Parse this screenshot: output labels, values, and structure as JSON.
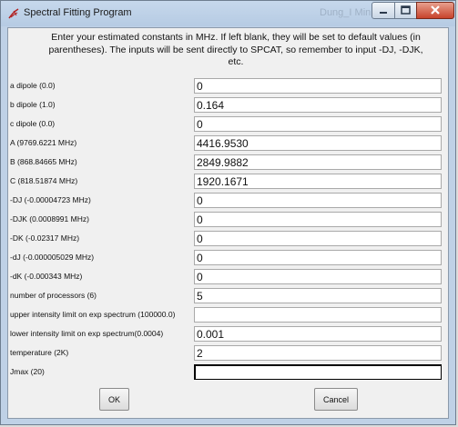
{
  "window": {
    "title": "Spectral Fitting Program",
    "background_title": "Dung_I Min Ver"
  },
  "intro_text": "Enter your estimated constants in MHz. If left blank, they will be set to default values (in parentheses). The inputs will be sent directly to SPCAT, so remember to input -DJ, -DJK, etc.",
  "fields": [
    {
      "label": "a dipole (0.0)",
      "value": "0"
    },
    {
      "label": "b dipole (1.0)",
      "value": "0.164"
    },
    {
      "label": "c dipole (0.0)",
      "value": "0"
    },
    {
      "label": "A (9769.6221 MHz)",
      "value": "4416.9530"
    },
    {
      "label": "B (868.84665 MHz)",
      "value": "2849.9882"
    },
    {
      "label": "C (818.51874 MHz)",
      "value": "1920.1671"
    },
    {
      "label": "-DJ (-0.00004723 MHz)",
      "value": "0"
    },
    {
      "label": "-DJK (0.0008991 MHz)",
      "value": "0"
    },
    {
      "label": "-DK (-0.02317 MHz)",
      "value": "0"
    },
    {
      "label": "-dJ (-0.000005029 MHz)",
      "value": "0"
    },
    {
      "label": "-dK (-0.000343 MHz)",
      "value": "0"
    },
    {
      "label": "number of processors (6)",
      "value": "5"
    },
    {
      "label": "upper intensity limit on exp spectrum (100000.0)",
      "value": ""
    },
    {
      "label": "lower intensity limit on exp spectrum(0.0004)",
      "value": "0.001"
    },
    {
      "label": "temperature (2K)",
      "value": "2"
    },
    {
      "label": "Jmax (20)",
      "value": ""
    }
  ],
  "buttons": {
    "ok_label": "OK",
    "cancel_label": "Cancel"
  },
  "icons": {
    "app": "tk-feather-icon",
    "minimize": "minimize-icon",
    "maximize": "maximize-icon",
    "close": "close-icon"
  },
  "colors": {
    "titlebar": "#bfd1e6",
    "close_button": "#c7432b",
    "client_bg": "#f0f0f0"
  }
}
